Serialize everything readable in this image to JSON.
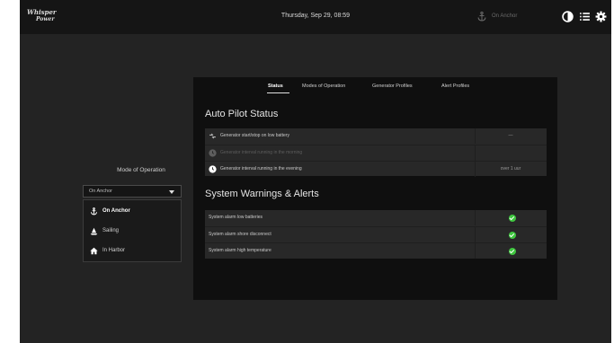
{
  "topbar": {
    "logo_line1": "Whisper",
    "logo_line2": "Power",
    "datetime": "Thursday, Sep 29, 08:59",
    "anchor_status": "On Anchor"
  },
  "mode": {
    "label": "Mode of Operation",
    "selected": "On Anchor",
    "options": [
      {
        "label": "On Anchor",
        "icon": "anchor-icon"
      },
      {
        "label": "Sailing",
        "icon": "sailboat-icon"
      },
      {
        "label": "In Harbor",
        "icon": "home-icon"
      }
    ]
  },
  "tabs": [
    "Status",
    "Modes of Operation",
    "Generator Profiles",
    "Alert Profiles"
  ],
  "autopilot": {
    "title": "Auto Pilot Status",
    "rows": [
      {
        "label": "Generator start/stop on low battery",
        "value": "—",
        "icon": "battery-swap-icon"
      },
      {
        "label": "Generator interval running in the morning",
        "value": "",
        "icon": "clock-icon"
      },
      {
        "label": "Generator interval running in the evening",
        "value": "over 1 uur",
        "icon": "clock-icon"
      }
    ]
  },
  "warnings": {
    "title": "System Warnings & Alerts",
    "rows": [
      {
        "label": "System alarm low batteries"
      },
      {
        "label": "System alarm shore disconnect"
      },
      {
        "label": "System alarm high temperature"
      }
    ]
  },
  "colors": {
    "background": "#232323",
    "panel": "#0f0f0f",
    "card": "#282828",
    "ok": "#3ec63e"
  }
}
